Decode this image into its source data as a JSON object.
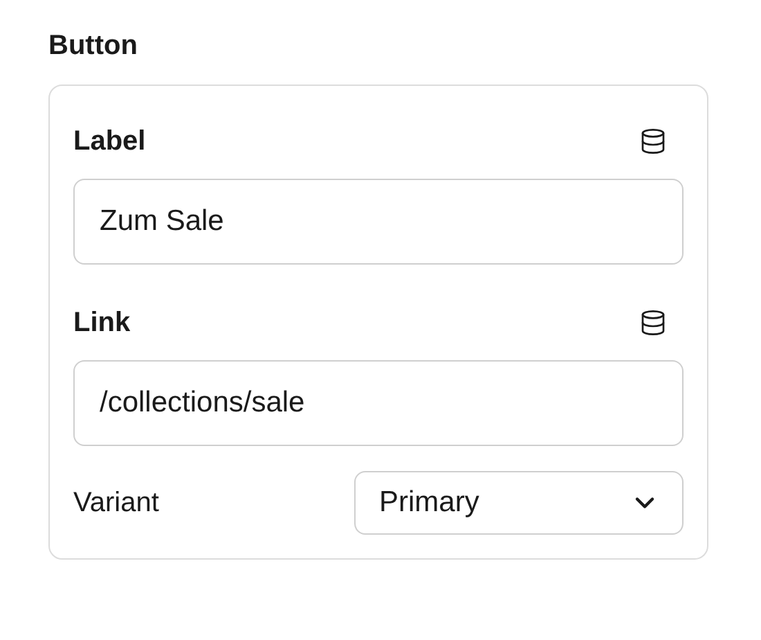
{
  "section": {
    "title": "Button"
  },
  "fields": [
    {
      "kind": "text",
      "label": "Label",
      "value": "Zum Sale",
      "bound": true
    },
    {
      "kind": "text",
      "label": "Link",
      "value": "/collections/sale",
      "bound": true
    },
    {
      "kind": "select",
      "label": "Variant",
      "value": "Primary"
    }
  ]
}
